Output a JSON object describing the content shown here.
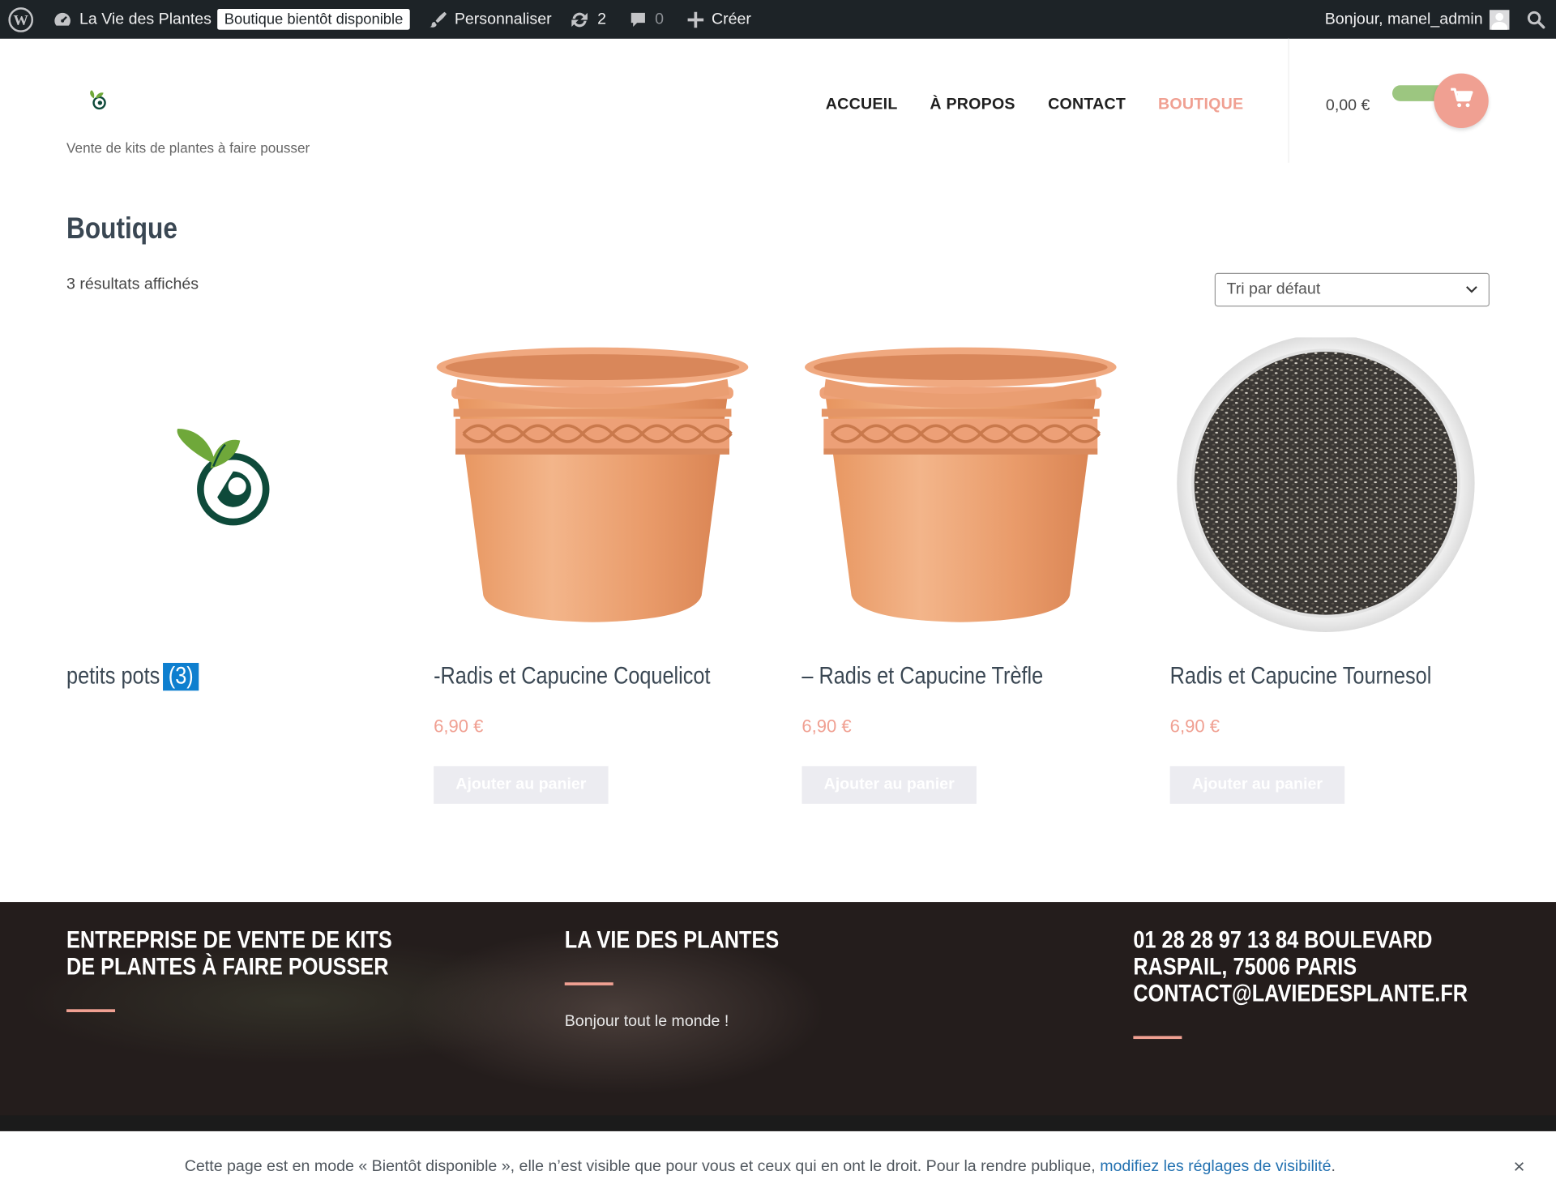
{
  "admin_bar": {
    "site_name": "La Vie des Plantes",
    "coming_soon": "Boutique bientôt disponible",
    "customize": "Personnaliser",
    "updates_count": "2",
    "comments_count": "0",
    "new": "Créer",
    "greeting": "Bonjour, manel_admin"
  },
  "header": {
    "tagline": "Vente de kits de plantes à faire pousser",
    "nav": [
      "ACCUEIL",
      "À PROPOS",
      "CONTACT",
      "BOUTIQUE"
    ],
    "active_nav": "BOUTIQUE",
    "cart_total": "0,00 €"
  },
  "main": {
    "title": "Boutique",
    "result_count": "3 résultats affichés",
    "sort_selected": "Tri par défaut",
    "category": {
      "name": "petits pots",
      "count": "(3)"
    },
    "products": [
      {
        "title": "-Radis et Capucine Coquelicot",
        "price": "6,90 €",
        "button": "Ajouter au panier",
        "image": "terracotta-pot"
      },
      {
        "title": "– Radis et Capucine Trèfle",
        "price": "6,90 €",
        "button": "Ajouter au panier",
        "image": "terracotta-pot"
      },
      {
        "title": "Radis et Capucine Tournesol",
        "price": "6,90 €",
        "button": "Ajouter au panier",
        "image": "chia-seeds-bowl"
      }
    ]
  },
  "footer": {
    "col1_heading": "ENTREPRISE DE VENTE DE KITS DE PLANTES À FAIRE POUSSER",
    "col2_heading": "LA VIE DES PLANTES",
    "col2_text": "Bonjour tout le monde !",
    "col3_heading": "01 28 28 97 13 84 BOULEVARD RASPAIL, 75006 PARIS CONTACT@LAVIEDESPLANTE.FR"
  },
  "notice": {
    "text": "Cette page est en mode « Bientôt disponible », elle n’est visible que pour vous et ceux qui en ont le droit. Pour la rendre publique, ",
    "link": "modifiez les réglages de visibilité",
    "end": ".",
    "close": "×"
  },
  "colors": {
    "accent": "#f0a092",
    "admin_bar": "#1d2327",
    "footer_bg": "#241d1c",
    "badge": "#0e7fcf",
    "link": "#2271b1"
  }
}
